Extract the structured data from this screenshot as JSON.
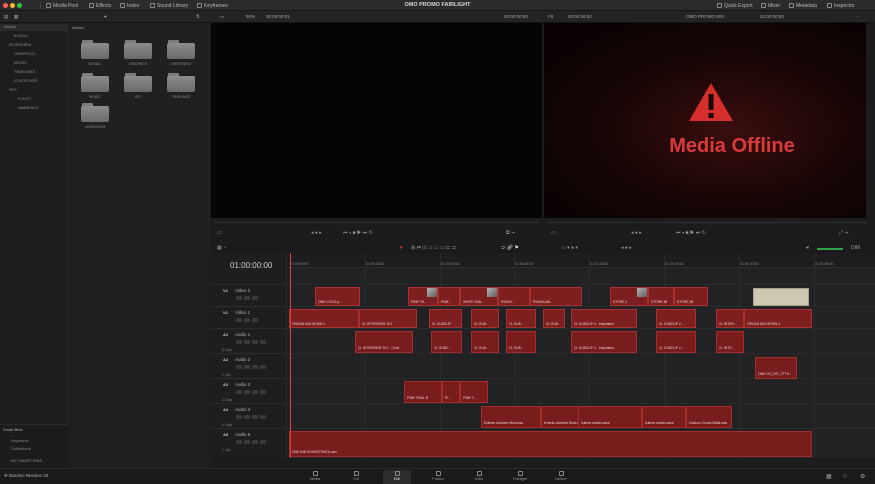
{
  "app": {
    "title": "OMO PROMO FAIRLIGHT",
    "brand": "DaVinci Resolve 20"
  },
  "topbar": {
    "left_tabs": [
      {
        "label": "Media Pool",
        "icon": "media-pool-icon"
      },
      {
        "label": "Effects",
        "icon": "effects-icon"
      },
      {
        "label": "Index",
        "icon": "index-icon"
      },
      {
        "label": "Sound Library",
        "icon": "sound-library-icon"
      },
      {
        "label": "Keyframes",
        "icon": "keyframes-icon"
      }
    ],
    "right_tabs": [
      {
        "label": "Quick Export",
        "icon": "export-icon"
      },
      {
        "label": "Mixer",
        "icon": "mixer-icon"
      },
      {
        "label": "Metadata",
        "icon": "metadata-icon"
      },
      {
        "label": "Inspector",
        "icon": "inspector-icon"
      }
    ]
  },
  "subbar": {
    "zoom": "50%",
    "timecode_left": "00:00:00:01",
    "timecode_src": "00:00:00:00",
    "fit": "Fit",
    "timecode_prog": "00:00:16:52",
    "clip_name": "OMO PROMO MIX",
    "timecode_right": "01:00:00:00"
  },
  "bins": {
    "master": "Master",
    "items": [
      "B-ROLL",
      "INTERVIEW",
      "GRAPHICS",
      "MUSIC",
      "TIMELINES",
      "VOICEOVER",
      "SFX",
      "FOLEY",
      "AMBIENCE"
    ],
    "smart_bins": "Smart Bins",
    "smart_items": [
      "Keywords",
      "Collections",
      "MY SMART BINS"
    ]
  },
  "pool": {
    "header": "Master",
    "folders": [
      "B-ROLL",
      "GRAPHICS",
      "INTERVIEW",
      "MUSIC",
      "SFX",
      "TIMELINES",
      "VOICEOVER"
    ]
  },
  "viewer": {
    "offline_text": "Media Offline"
  },
  "timeline": {
    "timecode": "01:00:00:00",
    "ruler": [
      "01:00:00:00",
      "01:00:15:00",
      "01:00:30:00",
      "01:00:45:00",
      "01:01:00:00",
      "01:01:15:00",
      "01:01:30:00",
      "01:01:45:00"
    ],
    "tracks": [
      {
        "id": "V2",
        "name": "Video 2",
        "count": ""
      },
      {
        "id": "V1",
        "name": "Video 1",
        "count": ""
      },
      {
        "id": "A1",
        "name": "Audio 1",
        "count": "8 Clips"
      },
      {
        "id": "A2",
        "name": "Audio 2",
        "count": "1 Clip"
      },
      {
        "id": "A3",
        "name": "Audio 3",
        "count": "4 Clips"
      },
      {
        "id": "A4",
        "name": "Audio 4",
        "count": "5 Clips"
      },
      {
        "id": "A5",
        "name": "Audio 5",
        "count": "1 Clip"
      }
    ],
    "v2_clips": [
      "OMO LOGO.p...",
      "PINE TR...",
      "PINE...",
      "WHITE SAN...",
      "PINA B...",
      "PINA BLAN...",
      "STORE 2",
      "STORE 3B",
      "STORE 2B"
    ],
    "v1_clips": [
      "ORGAN MOUNTAIN 1",
      "CL INTERVIEW TILT",
      "CL SUBCLIP",
      "CL SUB...",
      "CL SUB...",
      "CL SUB...",
      "CL SUBCLIP 4 - Inspiration",
      "CL SUBCLIP 2 -...",
      "CL INTER...",
      "ORGAN MOUNTAIN 1"
    ],
    "a1_clips": [
      "CL INTERVIEW TILT - Chris",
      "CL SUBC...",
      "CL SUB...",
      "CL SUB...",
      "CL SUBCLIP 4 - Inspiration...",
      "CL SUBCLIP 2...",
      "CL INTE..."
    ],
    "a2_clips": [
      "OMO VO_001_FTTH..."
    ],
    "a3_clips": [
      "PINE TRAIL B",
      "PI...",
      "PINE T..."
    ],
    "a4_clips": [
      "Exterior Ambient Wind.wav",
      "Exterior Ambient Birds.wave",
      "Interior ambie.wave",
      "Interior ambie.wave",
      "Outdoor Crowd Walla.wav"
    ],
    "a5_clips": [
      "ONE MIN SOUNDTRACK.wav"
    ]
  },
  "pages": [
    "Media",
    "Cut",
    "Edit",
    "Fusion",
    "Color",
    "Fairlight",
    "Deliver"
  ],
  "active_page": "Edit",
  "colors": {
    "accent_red": "#d93a3a",
    "clip_red": "#7d1f1f",
    "background": "#1c1c1e"
  }
}
